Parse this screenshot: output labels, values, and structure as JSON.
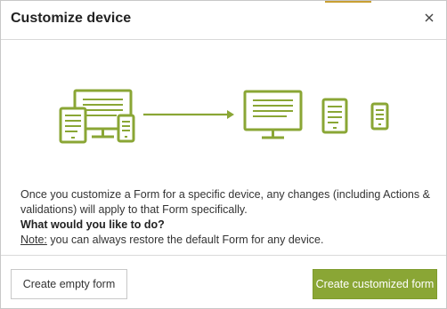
{
  "dialog": {
    "title": "Customize device",
    "close_icon": "close-icon"
  },
  "colors": {
    "accent_green": "#8aa635",
    "icon_green": "#8aa635",
    "top_accent": "#c8a033"
  },
  "illustration": {
    "icons": [
      "desktop-icon",
      "tablet-icon",
      "phone-icon",
      "arrow-right-icon",
      "desktop-icon",
      "tablet-icon",
      "phone-icon"
    ]
  },
  "description": {
    "line1": "Once you customize a Form for a specific device, any changes (including Actions & validations) will apply to that Form specifically.",
    "question": "What would you like to do?",
    "note_label": "Note:",
    "note_text": " you can always restore the default Form for any device."
  },
  "footer": {
    "secondary_label": "Create empty form",
    "primary_label": "Create customized form"
  }
}
